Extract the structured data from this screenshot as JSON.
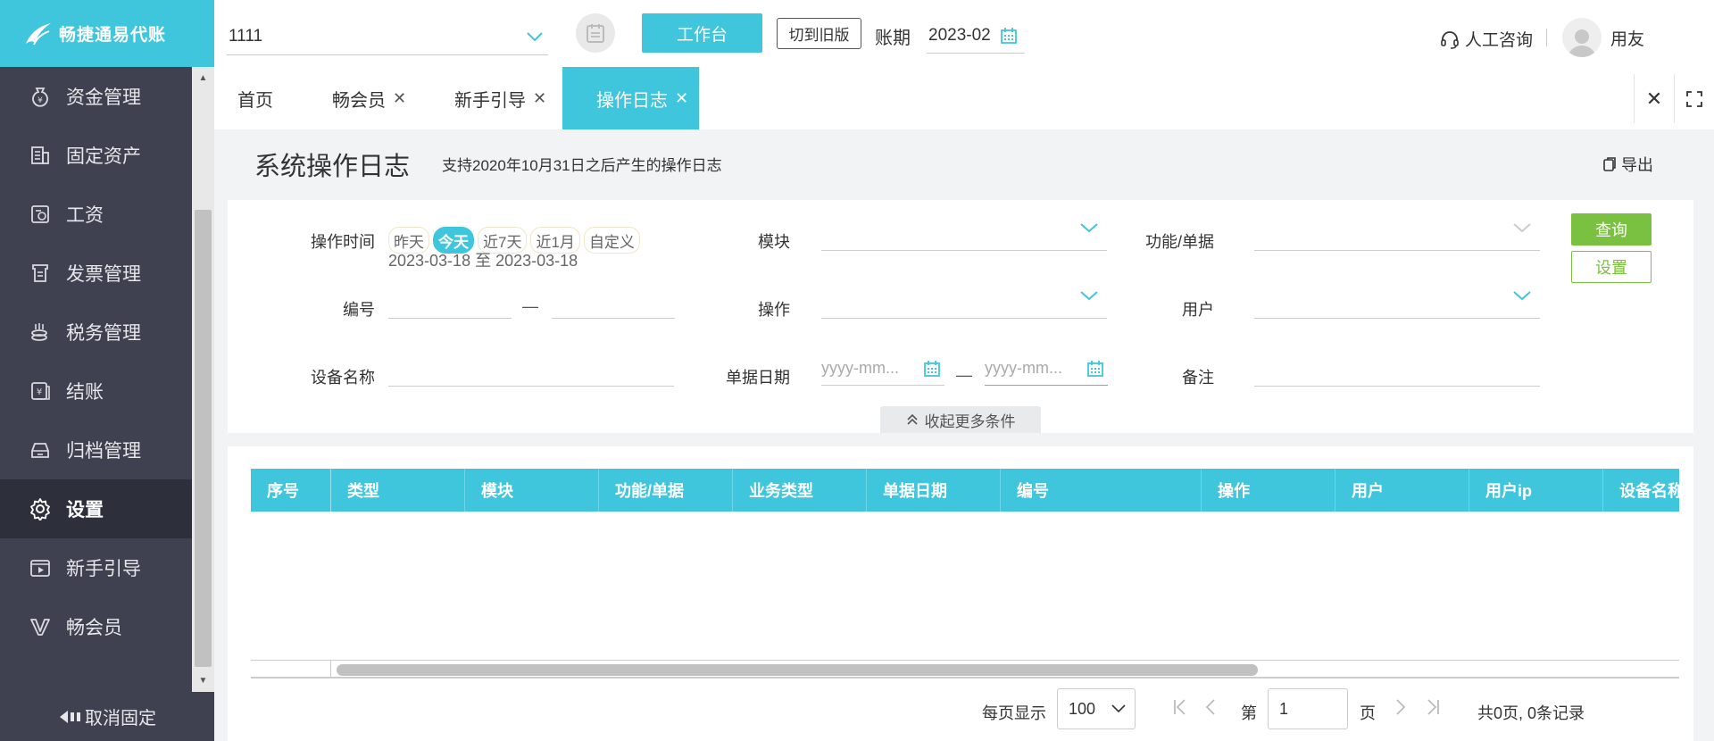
{
  "app": {
    "name": "畅捷通易代账"
  },
  "sidebar": {
    "items": [
      {
        "label": "资金管理",
        "icon": "money-bag-icon",
        "active": false
      },
      {
        "label": "固定资产",
        "icon": "building-icon",
        "active": false
      },
      {
        "label": "工资",
        "icon": "payroll-icon",
        "active": false
      },
      {
        "label": "发票管理",
        "icon": "invoice-icon",
        "active": false
      },
      {
        "label": "税务管理",
        "icon": "tax-icon",
        "active": false
      },
      {
        "label": "结账",
        "icon": "checkout-icon",
        "active": false
      },
      {
        "label": "归档管理",
        "icon": "archive-icon",
        "active": false
      },
      {
        "label": "设置",
        "icon": "gear-icon",
        "active": true
      },
      {
        "label": "新手引导",
        "icon": "video-guide-icon",
        "active": false
      },
      {
        "label": "畅会员",
        "icon": "vip-icon",
        "active": false
      }
    ],
    "unpin_label": "取消固定"
  },
  "topbar": {
    "company": "1111",
    "workbench_label": "工作台",
    "old_version_label": "切到旧版",
    "period_label": "账期",
    "period_value": "2023-02",
    "consult_label": "人工咨询",
    "user_name": "用友"
  },
  "tabs": [
    {
      "label": "首页",
      "closable": false,
      "active": false
    },
    {
      "label": "畅会员",
      "closable": true,
      "active": false
    },
    {
      "label": "新手引导",
      "closable": true,
      "active": false
    },
    {
      "label": "操作日志",
      "closable": true,
      "active": true
    }
  ],
  "page": {
    "title": "系统操作日志",
    "subtitle": "支持2020年10月31日之后产生的操作日志",
    "export_label": "导出"
  },
  "filter": {
    "op_time_label": "操作时间",
    "quick_ranges": [
      "昨天",
      "今天",
      "近7天",
      "近1月",
      "自定义"
    ],
    "quick_selected": "今天",
    "date_range": "2023-03-18 至 2023-03-18",
    "module_label": "模块",
    "function_label": "功能/单据",
    "number_label": "编号",
    "range_sep": "—",
    "operation_label": "操作",
    "user_label": "用户",
    "device_label": "设备名称",
    "doc_date_label": "单据日期",
    "date_placeholder": "yyyy-mm...",
    "remark_label": "备注",
    "query_label": "查询",
    "settings_label": "设置",
    "collapse_label": "收起更多条件"
  },
  "table": {
    "columns": [
      "序号",
      "类型",
      "模块",
      "功能/单据",
      "业务类型",
      "单据日期",
      "编号",
      "操作",
      "用户",
      "用户ip",
      "设备名称"
    ],
    "rows": []
  },
  "pagination": {
    "per_page_label": "每页显示",
    "per_page": "100",
    "page_prefix": "第",
    "page": "1",
    "page_suffix": "页",
    "total": "共0页, 0条记录"
  },
  "colors": {
    "accent": "#3fc6dc",
    "green": "#7ac142",
    "sidebar_bg": "#3f4150"
  }
}
